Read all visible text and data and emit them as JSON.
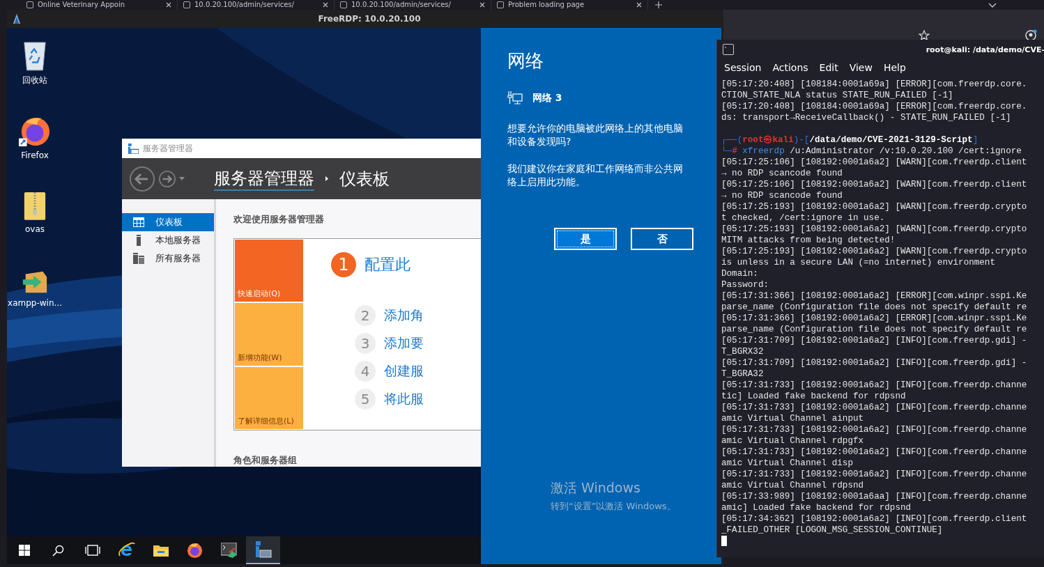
{
  "browser_tabs": [
    {
      "title": "Online Veterinary Appoin"
    },
    {
      "title": "10.0.20.100/admin/services/"
    },
    {
      "title": "10.0.20.100/admin/services/"
    },
    {
      "title": "Problem loading page"
    }
  ],
  "rdp_window": {
    "title": "FreeRDP: 10.0.20.100"
  },
  "desktop_icons": [
    {
      "label": "回收站",
      "kind": "recycle-bin"
    },
    {
      "label": "Firefox",
      "kind": "firefox"
    },
    {
      "label": "ovas",
      "kind": "zip-folder"
    },
    {
      "label": "xampp-win...",
      "kind": "installer"
    }
  ],
  "server_manager": {
    "title": "服务器管理器",
    "breadcrumb": [
      "服务器管理器",
      "仪表板"
    ],
    "nav": [
      {
        "label": "仪表板",
        "kind": "dashboard",
        "selected": true
      },
      {
        "label": "本地服务器",
        "kind": "server",
        "selected": false
      },
      {
        "label": "所有服务器",
        "kind": "servers",
        "selected": false
      }
    ],
    "welcome": "欢迎使用服务器管理器",
    "tiles": [
      {
        "label": "快速启动(Q)",
        "selected": true
      },
      {
        "label": "新增功能(W)",
        "selected": false
      },
      {
        "label": "了解详细信息(L)",
        "selected": false
      }
    ],
    "steps": [
      {
        "number": "1",
        "label": "配置此",
        "selected": true
      },
      {
        "number": "2",
        "label": "添加角",
        "selected": false
      },
      {
        "number": "3",
        "label": "添加要",
        "selected": false
      },
      {
        "number": "4",
        "label": "创建服",
        "selected": false
      },
      {
        "number": "5",
        "label": "将此服",
        "selected": false
      }
    ],
    "section": "角色和服务器组"
  },
  "network_panel": {
    "title": "网络",
    "network_name": "网络 3",
    "paragraphs": [
      "想要允许你的电脑被此网络上的其他电脑和设备发现吗?",
      "我们建议你在家庭和工作网络而非公共网络上启用此功能。"
    ],
    "buttons": [
      {
        "label": "是",
        "focused": true
      },
      {
        "label": "否",
        "focused": false
      }
    ]
  },
  "activation": {
    "title": "激活 Windows",
    "hint": "转到“设置”以激活 Windows。"
  },
  "taskbar": [
    {
      "kind": "start",
      "active": false
    },
    {
      "kind": "search",
      "active": false
    },
    {
      "kind": "task-view",
      "active": false
    },
    {
      "kind": "ie",
      "active": false
    },
    {
      "kind": "explorer",
      "active": false
    },
    {
      "kind": "firefox",
      "active": false
    },
    {
      "kind": "terminal",
      "active": false
    },
    {
      "kind": "server-manager",
      "active": true
    }
  ],
  "terminal": {
    "title": "root@kali: /data/demo/CVE-",
    "menu": [
      "Session",
      "Actions",
      "Edit",
      "View",
      "Help"
    ],
    "lines": [
      {
        "kind": "text",
        "text": "[05:17:20:408] [108184:0001a69a] [ERROR][com.freerdp.core."
      },
      {
        "kind": "text",
        "text": "CTION_STATE_NLA status STATE_RUN_FAILED [-1]"
      },
      {
        "kind": "text",
        "text": "[05:17:20:408] [108184:0001a69a] [ERROR][com.freerdp.core."
      },
      {
        "kind": "text",
        "text": "ds: transport→ReceiveCallback() - STATE_RUN_FAILED [-1]"
      },
      {
        "kind": "blank"
      },
      {
        "kind": "prompt",
        "segments": [
          {
            "kind": "frame",
            "text": "┌──("
          },
          {
            "kind": "user",
            "text": "root㉿kali"
          },
          {
            "kind": "frame",
            "text": ")-["
          },
          {
            "kind": "path",
            "text": "/data/demo/CVE-2021-3129-Script"
          },
          {
            "kind": "frame",
            "text": "]"
          }
        ]
      },
      {
        "kind": "prompt",
        "segments": [
          {
            "kind": "frame",
            "text": "└─"
          },
          {
            "kind": "user",
            "text": "#"
          },
          {
            "kind": "cmd",
            "text": " xfreerdp"
          },
          {
            "kind": "arg",
            "text": " /u:Administrator /v:10.0.20.100 /cert:ignore"
          }
        ]
      },
      {
        "kind": "text",
        "text": "[05:17:25:106] [108192:0001a6a2] [WARN][com.freerdp.client"
      },
      {
        "kind": "text",
        "text": "→ no RDP scancode found"
      },
      {
        "kind": "text",
        "text": "[05:17:25:106] [108192:0001a6a2] [WARN][com.freerdp.client"
      },
      {
        "kind": "text",
        "text": "→ no RDP scancode found"
      },
      {
        "kind": "text",
        "text": "[05:17:25:193] [108192:0001a6a2] [WARN][com.freerdp.crypto"
      },
      {
        "kind": "text",
        "text": "t checked, /cert:ignore in use."
      },
      {
        "kind": "text",
        "text": "[05:17:25:193] [108192:0001a6a2] [WARN][com.freerdp.crypto"
      },
      {
        "kind": "text",
        "text": "MITM attacks from being detected!"
      },
      {
        "kind": "text",
        "text": "[05:17:25:193] [108192:0001a6a2] [WARN][com.freerdp.crypto"
      },
      {
        "kind": "text",
        "text": "is unless in a secure LAN (=no internet) environment"
      },
      {
        "kind": "text",
        "text": "Domain:"
      },
      {
        "kind": "text",
        "text": "Password:"
      },
      {
        "kind": "text",
        "text": "[05:17:31:366] [108192:0001a6a2] [ERROR][com.winpr.sspi.Ke"
      },
      {
        "kind": "text",
        "text": "parse_name (Configuration file does not specify default re"
      },
      {
        "kind": "text",
        "text": "[05:17:31:366] [108192:0001a6a2] [ERROR][com.winpr.sspi.Ke"
      },
      {
        "kind": "text",
        "text": "parse_name (Configuration file does not specify default re"
      },
      {
        "kind": "text",
        "text": "[05:17:31:709] [108192:0001a6a2] [INFO][com.freerdp.gdi] -"
      },
      {
        "kind": "text",
        "text": "T_BGRX32"
      },
      {
        "kind": "text",
        "text": "[05:17:31:709] [108192:0001a6a2] [INFO][com.freerdp.gdi] -"
      },
      {
        "kind": "text",
        "text": "T_BGRA32"
      },
      {
        "kind": "text",
        "text": "[05:17:31:733] [108192:0001a6a2] [INFO][com.freerdp.channe"
      },
      {
        "kind": "text",
        "text": "tic] Loaded fake backend for rdpsnd"
      },
      {
        "kind": "text",
        "text": "[05:17:31:733] [108192:0001a6a2] [INFO][com.freerdp.channe"
      },
      {
        "kind": "text",
        "text": "amic Virtual Channel ainput"
      },
      {
        "kind": "text",
        "text": "[05:17:31:733] [108192:0001a6a2] [INFO][com.freerdp.channe"
      },
      {
        "kind": "text",
        "text": "amic Virtual Channel rdpgfx"
      },
      {
        "kind": "text",
        "text": "[05:17:31:733] [108192:0001a6a2] [INFO][com.freerdp.channe"
      },
      {
        "kind": "text",
        "text": "amic Virtual Channel disp"
      },
      {
        "kind": "text",
        "text": "[05:17:31:733] [108192:0001a6a2] [INFO][com.freerdp.channe"
      },
      {
        "kind": "text",
        "text": "amic Virtual Channel rdpsnd"
      },
      {
        "kind": "text",
        "text": "[05:17:33:989] [108192:0001a6aa] [INFO][com.freerdp.channe"
      },
      {
        "kind": "text",
        "text": "amic] Loaded fake backend for rdpsnd"
      },
      {
        "kind": "text",
        "text": "[05:17:34:362] [108192:0001a6a2] [INFO][com.freerdp.client"
      },
      {
        "kind": "text",
        "text": "_FAILED_OTHER [LOGON_MSG_SESSION_CONTINUE]"
      },
      {
        "kind": "cursor"
      }
    ]
  }
}
